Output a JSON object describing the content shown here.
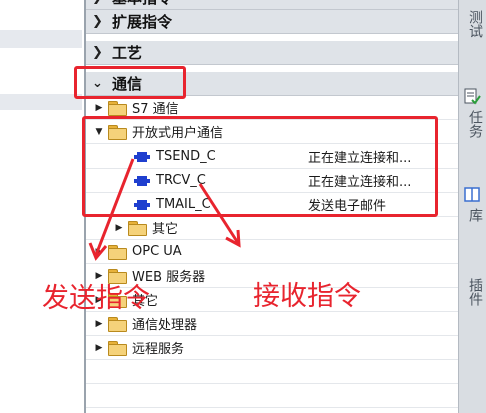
{
  "categories": [
    {
      "label": "基本指令",
      "expanded": false
    },
    {
      "label": "扩展指令",
      "expanded": false
    },
    {
      "label": "工艺",
      "expanded": false
    },
    {
      "label": "通信",
      "expanded": true
    }
  ],
  "tree": {
    "s7": "S7 通信",
    "open_user": "开放式用户通信",
    "instructions": [
      {
        "name": "TSEND_C",
        "desc": "正在建立连接和..."
      },
      {
        "name": "TRCV_C",
        "desc": "正在建立连接和..."
      },
      {
        "name": "TMAIL_C",
        "desc": "发送电子邮件"
      }
    ],
    "other_sub": "其它",
    "opc_ua": "OPC UA",
    "web_server": "WEB 服务器",
    "other": "其它",
    "comm_processor": "通信处理器",
    "remote_service": "远程服务"
  },
  "side_tabs": [
    {
      "label": "测试",
      "icon": "test-icon"
    },
    {
      "label": "任务",
      "icon": "tasks-icon"
    },
    {
      "label": "库",
      "icon": "library-icon"
    },
    {
      "label": "插件",
      "icon": "plugins-icon"
    }
  ],
  "annotations": {
    "send": "发送指令",
    "receive": "接收指令",
    "color": "#e8242e"
  }
}
